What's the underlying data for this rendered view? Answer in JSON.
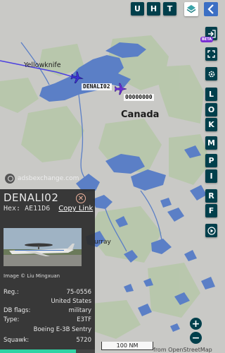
{
  "toolbar": {
    "buttons": [
      {
        "label": "U",
        "icon": ""
      },
      {
        "label": "H",
        "icon": ""
      },
      {
        "label": "T",
        "icon": ""
      }
    ],
    "layers_icon": "layers-icon",
    "collapse_icon": "chevron-left-icon"
  },
  "sidebar": {
    "login_icon": "login-arrow-icon",
    "beta_badge": "BETA",
    "fullscreen_icon": "fullscreen-icon",
    "settings_icon": "gear-icon",
    "letter_buttons": [
      "L",
      "O",
      "K",
      "M",
      "P",
      "I",
      "R",
      "F"
    ],
    "replay_icon": "play-circle-icon"
  },
  "map": {
    "places": {
      "yellowknife": "Yellowknife",
      "canada": "Canada",
      "murray": "urray"
    },
    "aircraft": [
      {
        "label": "DENALI02",
        "color": "#3b2fd4"
      },
      {
        "label": "00000000",
        "color": "#6a2fd4"
      }
    ],
    "watermark": "adsbexchange.com",
    "track_color": "#4b3fe0"
  },
  "panel": {
    "callsign": "DENALI02",
    "hex_label": "Hex:",
    "hex_value": "AE11D6",
    "copy_link": "Copy Link",
    "close_icon": "close-circle-icon",
    "photo_credit": "Image © Liu Mingxuan",
    "fields": [
      {
        "key": "Reg.:",
        "value": "75-0556"
      },
      {
        "key": "",
        "value": "United States"
      },
      {
        "key": "DB flags:",
        "value": "military"
      },
      {
        "key": "Type:",
        "value": "E3TF"
      },
      {
        "key": "",
        "value": "Boeing E-3B Sentry"
      },
      {
        "key": "Squawk:",
        "value": "5720"
      }
    ],
    "progress_fraction": 0.8
  },
  "zoom": {
    "in_label": "+",
    "out_label": "−"
  },
  "scale": {
    "label": "100 NM"
  },
  "attribution": "from OpenStreetMap"
}
